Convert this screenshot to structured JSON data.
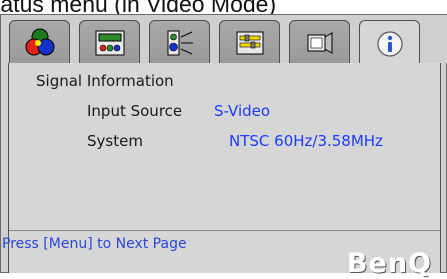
{
  "caption": "tatus menu (in Video Mode)",
  "tabs": [
    {
      "icon": "picture-color-icon",
      "active": false
    },
    {
      "icon": "picture-advanced-icon",
      "active": false
    },
    {
      "icon": "audio-icon",
      "active": false
    },
    {
      "icon": "setup-icon",
      "active": false
    },
    {
      "icon": "source-icon",
      "active": false
    },
    {
      "icon": "information-icon",
      "active": true
    }
  ],
  "panel": {
    "section_title": "Signal Information",
    "rows": [
      {
        "label": "Input Source",
        "value": "S-Video"
      },
      {
        "label": "System",
        "value": "NTSC 60Hz/3.58MHz"
      }
    ],
    "footer_hint": "Press [Menu] to Next Page",
    "brand": "BenQ"
  },
  "colors": {
    "value_text": "#1a3cff",
    "footer_text": "#2b46d8",
    "panel_bg": "#d6d6d6",
    "tab_bg": "#9f9f9f"
  }
}
